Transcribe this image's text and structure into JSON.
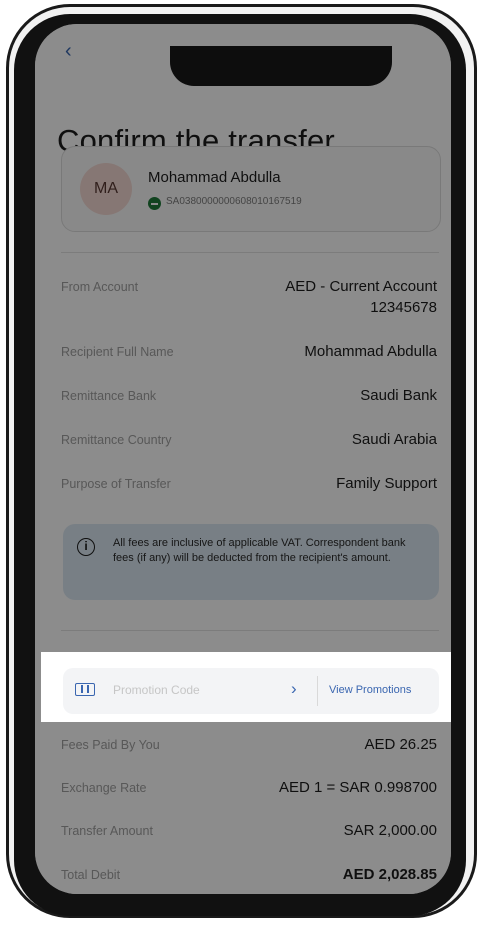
{
  "header": {
    "title": "Confirm the transfer"
  },
  "recipient": {
    "initials": "MA",
    "name": "Mohammad Abdulla",
    "iban": "SA0380000000608010167519"
  },
  "details": [
    {
      "label": "From Account",
      "value_line1": "AED - Current Account",
      "value_line2": "12345678"
    },
    {
      "label": "Recipient Full Name",
      "value": "Mohammad Abdulla"
    },
    {
      "label": "Remittance Bank",
      "value": "Saudi Bank"
    },
    {
      "label": "Remittance Country",
      "value": "Saudi Arabia"
    },
    {
      "label": "Purpose of Transfer",
      "value": "Family Support"
    }
  ],
  "info": {
    "text": "All fees are inclusive of applicable VAT. Correspondent bank fees (if any) will be deducted from the recipient's amount."
  },
  "promotion": {
    "placeholder": "Promotion Code",
    "view_label": "View Promotions"
  },
  "summary": [
    {
      "label": "Fees Paid By You",
      "value": "AED 26.25"
    },
    {
      "label": "Exchange Rate",
      "value": "AED 1 = SAR 0.998700"
    },
    {
      "label": "Transfer Amount",
      "value": "SAR 2,000.00"
    },
    {
      "label": "Total Debit",
      "value": "AED 2,028.85"
    }
  ],
  "colors": {
    "accent": "#3a66b0",
    "info_bg": "#dbe8f2",
    "avatar_bg": "#f4d9d3"
  }
}
